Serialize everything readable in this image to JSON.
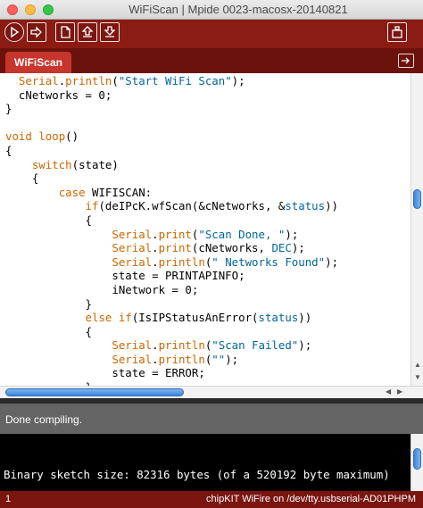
{
  "window": {
    "title": "WiFiScan | Mpide 0023-macosx-20140821"
  },
  "toolbar": {
    "buttons": [
      "verify-icon",
      "upload-icon",
      "new-icon",
      "open-icon",
      "save-icon",
      "serial-monitor-icon"
    ]
  },
  "tabs": {
    "active": "WiFiScan"
  },
  "editor": {
    "lines": [
      [
        [
          "fn",
          "  Serial"
        ],
        [
          "id",
          "."
        ],
        [
          "fn",
          "println"
        ],
        [
          "id",
          "("
        ],
        [
          "str",
          "\"Start WiFi Scan\""
        ],
        [
          "id",
          ");"
        ]
      ],
      [
        [
          "id",
          "  cNetworks = 0;"
        ]
      ],
      [
        [
          "id",
          "}"
        ]
      ],
      [
        [
          "id",
          ""
        ]
      ],
      [
        [
          "kw",
          "void"
        ],
        [
          "id",
          " "
        ],
        [
          "fn",
          "loop"
        ],
        [
          "id",
          "()"
        ]
      ],
      [
        [
          "id",
          "{"
        ]
      ],
      [
        [
          "id",
          "    "
        ],
        [
          "kw",
          "switch"
        ],
        [
          "id",
          "(state)"
        ]
      ],
      [
        [
          "id",
          "    {"
        ]
      ],
      [
        [
          "id",
          "        "
        ],
        [
          "kw",
          "case"
        ],
        [
          "id",
          " WIFISCAN:"
        ]
      ],
      [
        [
          "id",
          "            "
        ],
        [
          "kw",
          "if"
        ],
        [
          "id",
          "(deIPcK.wfScan(&cNetworks, &"
        ],
        [
          "lit",
          "status"
        ],
        [
          "id",
          "))"
        ]
      ],
      [
        [
          "id",
          "            {"
        ]
      ],
      [
        [
          "id",
          "                "
        ],
        [
          "fn",
          "Serial"
        ],
        [
          "id",
          "."
        ],
        [
          "fn",
          "print"
        ],
        [
          "id",
          "("
        ],
        [
          "str",
          "\"Scan Done, \""
        ],
        [
          "id",
          ");"
        ]
      ],
      [
        [
          "id",
          "                "
        ],
        [
          "fn",
          "Serial"
        ],
        [
          "id",
          "."
        ],
        [
          "fn",
          "print"
        ],
        [
          "id",
          "(cNetworks, "
        ],
        [
          "lit",
          "DEC"
        ],
        [
          "id",
          ");"
        ]
      ],
      [
        [
          "id",
          "                "
        ],
        [
          "fn",
          "Serial"
        ],
        [
          "id",
          "."
        ],
        [
          "fn",
          "println"
        ],
        [
          "id",
          "("
        ],
        [
          "str",
          "\" Networks Found\""
        ],
        [
          "id",
          ");"
        ]
      ],
      [
        [
          "id",
          "                state = PRINTAPINFO;"
        ]
      ],
      [
        [
          "id",
          "                iNetwork = 0;"
        ]
      ],
      [
        [
          "id",
          "            }"
        ]
      ],
      [
        [
          "id",
          "            "
        ],
        [
          "kw",
          "else if"
        ],
        [
          "id",
          "(IsIPStatusAnError("
        ],
        [
          "lit",
          "status"
        ],
        [
          "id",
          "))"
        ]
      ],
      [
        [
          "id",
          "            {"
        ]
      ],
      [
        [
          "id",
          "                "
        ],
        [
          "fn",
          "Serial"
        ],
        [
          "id",
          "."
        ],
        [
          "fn",
          "println"
        ],
        [
          "id",
          "("
        ],
        [
          "str",
          "\"Scan Failed\""
        ],
        [
          "id",
          ");"
        ]
      ],
      [
        [
          "id",
          "                "
        ],
        [
          "fn",
          "Serial"
        ],
        [
          "id",
          "."
        ],
        [
          "fn",
          "println"
        ],
        [
          "id",
          "("
        ],
        [
          "str",
          "\"\""
        ],
        [
          "id",
          ");"
        ]
      ],
      [
        [
          "id",
          "                state = ERROR;"
        ]
      ],
      [
        [
          "id",
          "            }"
        ]
      ]
    ]
  },
  "status": {
    "message": "Done compiling."
  },
  "console": {
    "output": "Binary sketch size: 82316 bytes (of a 520192 byte maximum)"
  },
  "footer": {
    "line_number": "1",
    "board": "chipKIT WiFire on /dev/tty.usbserial-AD01PHPM"
  },
  "colors": {
    "toolbar": "#8a1c14",
    "tab": "#c6362d",
    "function": "#cc6600",
    "string": "#006699"
  }
}
